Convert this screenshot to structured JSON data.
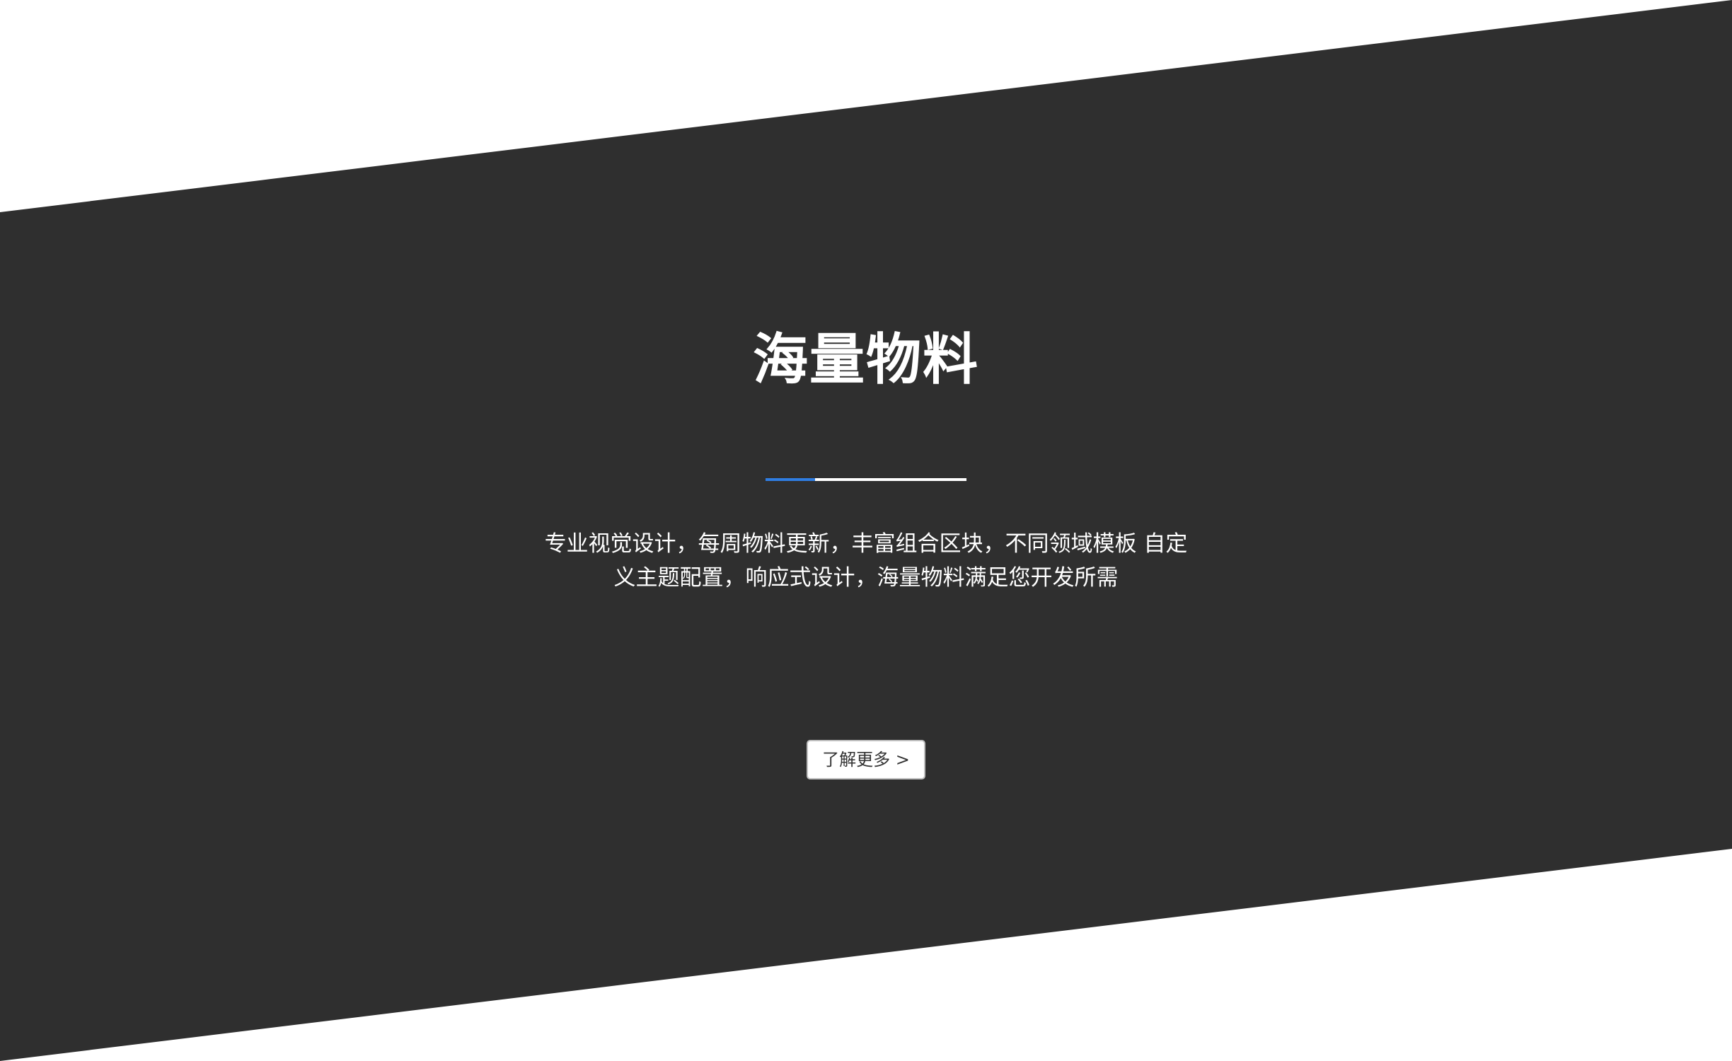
{
  "hero": {
    "title": "海量物料",
    "description": "专业视觉设计，每周物料更新，丰富组合区块，不同领域模板 自定义主题配置，响应式设计，海量物料满足您开发所需",
    "cta_label": "了解更多 >"
  },
  "colors": {
    "page_background": "#ffffff",
    "band": "#2f2f2f",
    "title_text": "#ffffff",
    "divider": "#ffffff",
    "divider_accent": "#2f7de1",
    "button_background": "#ffffff",
    "button_text": "#333333"
  }
}
